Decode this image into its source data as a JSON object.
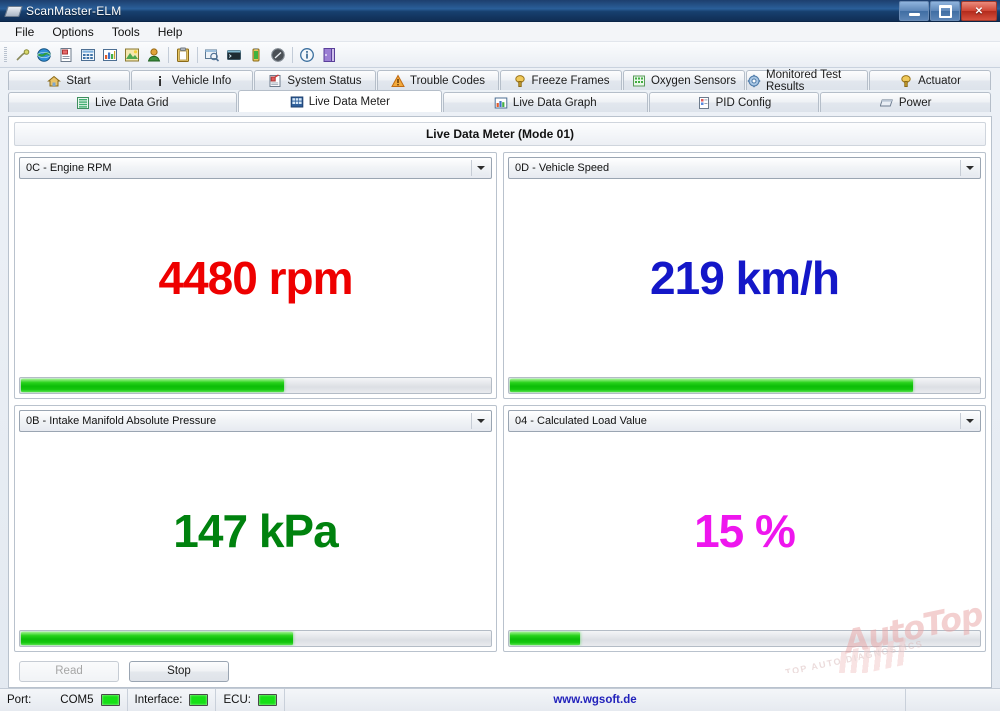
{
  "window": {
    "title": "ScanMaster-ELM",
    "icon": "chip-icon",
    "buttons": {
      "minimize": "–",
      "maximize": "❐",
      "close": "✕"
    }
  },
  "menu": {
    "items": [
      "File",
      "Options",
      "Tools",
      "Help"
    ]
  },
  "toolbar": {
    "icons": [
      "connect-icon",
      "globe-icon",
      "report-icon",
      "grid-icon",
      "chart-icon",
      "image-icon",
      "user-icon",
      "SEP",
      "clipboard-icon",
      "SEP2",
      "terminal-window-icon",
      "console-icon",
      "battery-icon",
      "gauge-icon",
      "SEP3",
      "info-icon",
      "exit-icon"
    ]
  },
  "tabs": {
    "row1": [
      {
        "label": "Start",
        "icon": "home-icon",
        "active": false
      },
      {
        "label": "Vehicle Info",
        "icon": "info-i-icon",
        "active": false
      },
      {
        "label": "System Status",
        "icon": "checklist-icon",
        "active": false
      },
      {
        "label": "Trouble Codes",
        "icon": "warning-icon",
        "active": false
      },
      {
        "label": "Freeze Frames",
        "icon": "snapshot-icon",
        "active": false
      },
      {
        "label": "Oxygen Sensors",
        "icon": "oxygen-icon",
        "active": false
      },
      {
        "label": "Monitored Test Results",
        "icon": "gear-icon",
        "active": false
      },
      {
        "label": "Actuator",
        "icon": "actuator-icon",
        "active": false
      }
    ],
    "row2": [
      {
        "label": "Live Data Grid",
        "icon": "list-icon",
        "active": false
      },
      {
        "label": "Live Data Meter",
        "icon": "meter-grid-icon",
        "active": true
      },
      {
        "label": "Live Data Graph",
        "icon": "bar-chart-icon",
        "active": false
      },
      {
        "label": "PID Config",
        "icon": "config-doc-icon",
        "active": false
      },
      {
        "label": "Power",
        "icon": "chip-icon",
        "active": false
      }
    ]
  },
  "panel": {
    "header": "Live Data Meter (Mode 01)",
    "meters": [
      {
        "pid": "0C - Engine RPM",
        "value": "4480 rpm",
        "color": "#ee0000",
        "fill_percent": 56
      },
      {
        "pid": "0D - Vehicle Speed",
        "value": "219 km/h",
        "color": "#1417c8",
        "fill_percent": 86
      },
      {
        "pid": "0B - Intake Manifold Absolute Pressure",
        "value": "147 kPa",
        "color": "#00820e",
        "fill_percent": 58
      },
      {
        "pid": "04 - Calculated Load Value",
        "value": "15 %",
        "color": "#ee16ee",
        "fill_percent": 15
      }
    ]
  },
  "actions": {
    "read_label": "Read",
    "read_disabled": true,
    "stop_label": "Stop"
  },
  "status": {
    "port_label": "Port:",
    "port_value": "COM5",
    "port_led": "#16e016",
    "interface_label": "Interface:",
    "interface_led": "#16e016",
    "ecu_label": "ECU:",
    "ecu_led": "#16e016",
    "website": "www.wgsoft.de"
  },
  "watermark": {
    "main": "AutoTop",
    "sub": "TOP AUTO DIAGNOSTICS"
  }
}
